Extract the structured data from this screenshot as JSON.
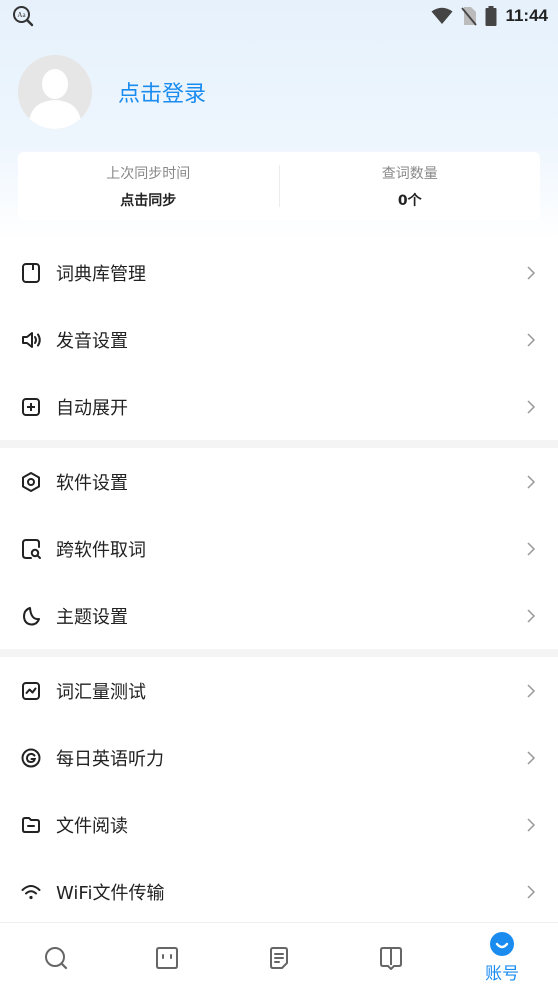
{
  "status_bar": {
    "time": "11:44"
  },
  "profile": {
    "login_text": "点击登录"
  },
  "stats": {
    "sync_label": "上次同步时间",
    "sync_value": "点击同步",
    "count_label": "查词数量",
    "count_value": "0个"
  },
  "menu": {
    "groups": [
      [
        {
          "label": "词典库管理",
          "icon": "dictionary-icon"
        },
        {
          "label": "发音设置",
          "icon": "speaker-icon"
        },
        {
          "label": "自动展开",
          "icon": "plus-box-icon"
        }
      ],
      [
        {
          "label": "软件设置",
          "icon": "hexagon-settings-icon"
        },
        {
          "label": "跨软件取词",
          "icon": "search-doc-icon"
        },
        {
          "label": "主题设置",
          "icon": "moon-icon"
        }
      ],
      [
        {
          "label": "词汇量测试",
          "icon": "chart-box-icon"
        },
        {
          "label": "每日英语听力",
          "icon": "circle-g-icon"
        },
        {
          "label": "文件阅读",
          "icon": "folder-icon"
        },
        {
          "label": "WiFi文件传输",
          "icon": "wifi-icon"
        }
      ]
    ]
  },
  "bottom_nav": {
    "active_label": "账号",
    "accent": "#1a8cf0"
  }
}
